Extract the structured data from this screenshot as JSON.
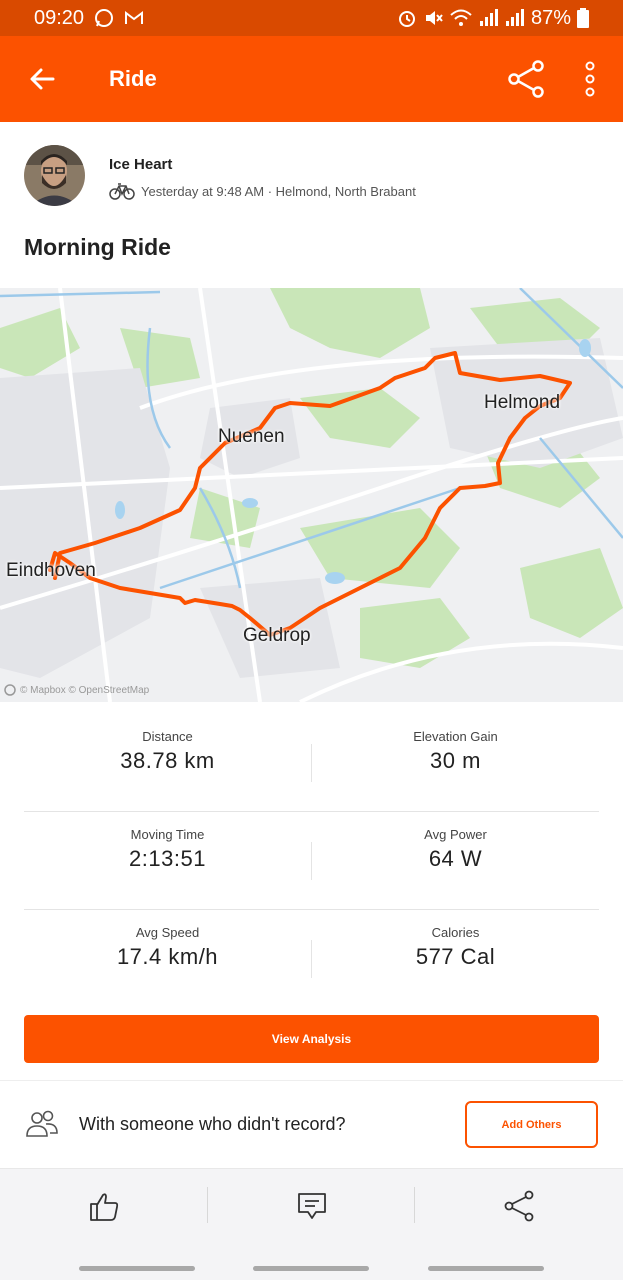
{
  "status": {
    "time": "09:20",
    "battery": "87%"
  },
  "appbar": {
    "title": "Ride"
  },
  "athlete": {
    "name": "Ice Heart",
    "meta": "Yesterday at 9:48 AM · Helmond, North Brabant"
  },
  "activity": {
    "title": "Morning Ride"
  },
  "map": {
    "labels": {
      "eindhoven": "Eindhoven",
      "nuenen": "Nuenen",
      "helmond": "Helmond",
      "geldrop": "Geldrop"
    },
    "attribution": "© Mapbox © OpenStreetMap",
    "route_color": "#fc5200"
  },
  "stats": {
    "distance": {
      "label": "Distance",
      "value": "38.78 km"
    },
    "elevation": {
      "label": "Elevation Gain",
      "value": "30 m"
    },
    "moving_time": {
      "label": "Moving Time",
      "value": "2:13:51"
    },
    "avg_power": {
      "label": "Avg Power",
      "value": "64 W"
    },
    "avg_speed": {
      "label": "Avg Speed",
      "value": "17.4 km/h"
    },
    "calories": {
      "label": "Calories",
      "value": "577 Cal"
    }
  },
  "actions": {
    "view_analysis": "View Analysis",
    "with_text": "With someone who didn't record?",
    "add_others": "Add Others"
  },
  "colors": {
    "accent": "#fc5200",
    "status_bar": "#d94a00"
  }
}
